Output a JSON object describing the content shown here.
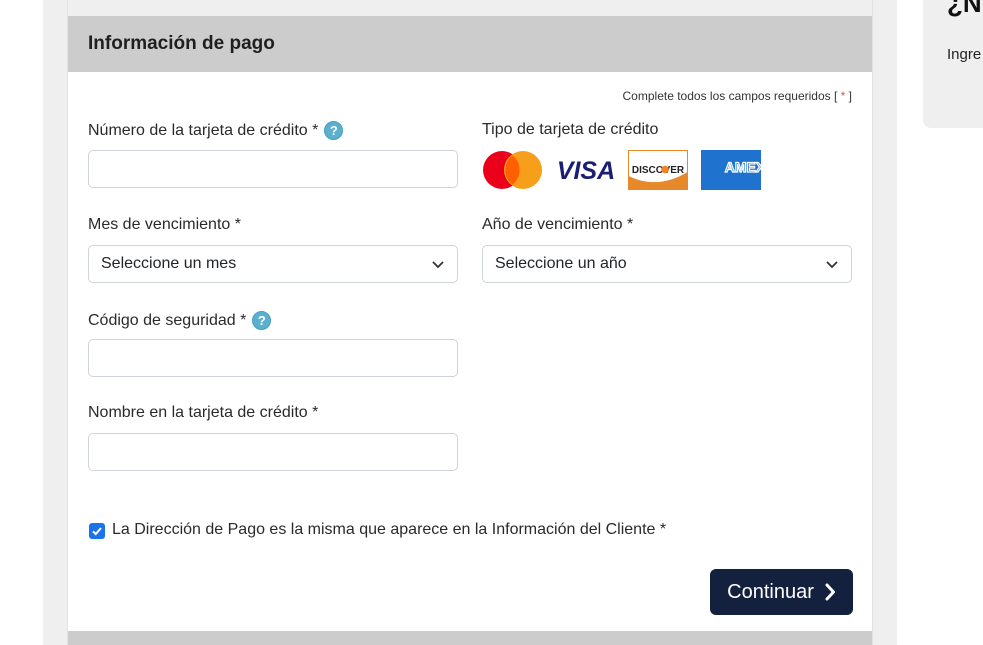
{
  "header": {
    "title": "Información de pago"
  },
  "required_note": {
    "prefix": "Complete todos los campos requeridos [",
    "star": "*",
    "suffix": "]"
  },
  "fields": {
    "card_number": {
      "label": "Número de la tarjeta de crédito *",
      "value": ""
    },
    "card_type": {
      "label": "Tipo de tarjeta de crédito",
      "visa_text": "VISA",
      "discover_text": "DISCOVER",
      "amex_text": "AMEX"
    },
    "exp_month": {
      "label": "Mes de vencimiento *",
      "selected": "Seleccione un mes"
    },
    "exp_year": {
      "label": "Año de vencimiento *",
      "selected": "Seleccione un año"
    },
    "security_code": {
      "label": "Código de seguridad *",
      "value": ""
    },
    "name_on_card": {
      "label": "Nombre en la tarjeta de crédito *",
      "value": ""
    }
  },
  "help_icon_glyph": "?",
  "billing_same": {
    "label": "La Dirección de Pago es la misma que aparece en la Información del Cliente *",
    "checked": true
  },
  "continue_button": {
    "label": "Continuar",
    "icon": "chevron-right-icon"
  },
  "side_panel": {
    "title": "¿Nu",
    "text": "Ingre crédit"
  },
  "colors": {
    "button_bg": "#13213f",
    "header_bg": "#cccccc",
    "checkbox": "#1a73e8",
    "help": "#5bb0cf"
  }
}
